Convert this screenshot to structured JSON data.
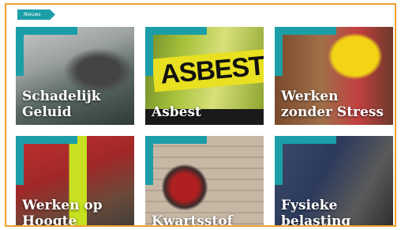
{
  "header": {
    "badge_label": "Nieuws"
  },
  "tiles": [
    {
      "title": "Schadelijk\nGeluid"
    },
    {
      "title": "Asbest",
      "sign_text": "ASBEST"
    },
    {
      "title": "Werken\nzonder Stress"
    },
    {
      "title": "Werken op\nHoogte"
    },
    {
      "title": "Kwartsstof"
    },
    {
      "title": "Fysieke\nbelasting"
    }
  ],
  "colors": {
    "accent": "#1c9ea8",
    "border": "#f0a030"
  }
}
